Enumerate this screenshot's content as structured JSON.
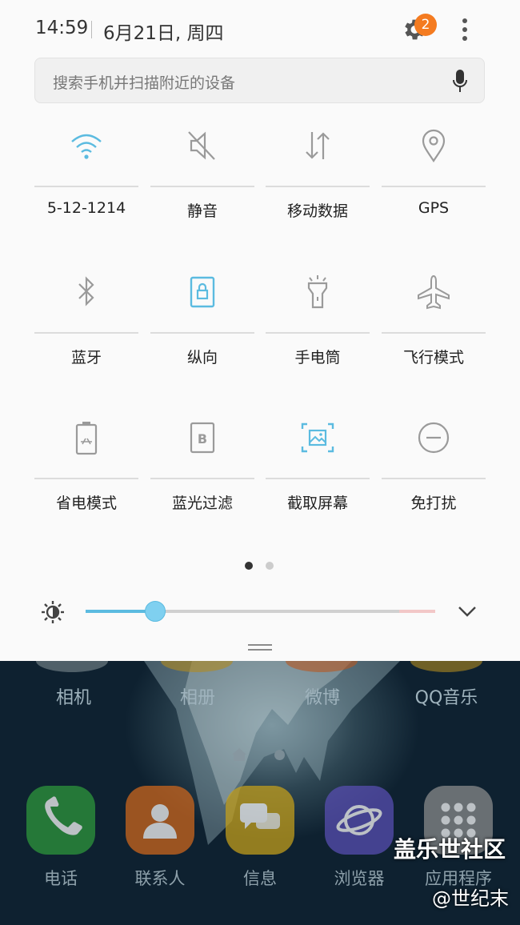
{
  "status_bar": {
    "time": "14:59",
    "date": "6月21日, 周四",
    "notification_count": "2"
  },
  "search": {
    "placeholder": "搜索手机并扫描附近的设备"
  },
  "quick_settings": [
    {
      "label": "5-12-1214",
      "icon": "wifi-icon",
      "active": true
    },
    {
      "label": "静音",
      "icon": "mute-icon",
      "active": false
    },
    {
      "label": "移动数据",
      "icon": "mobile-data-icon",
      "active": false
    },
    {
      "label": "GPS",
      "icon": "location-pin-icon",
      "active": false
    },
    {
      "label": "蓝牙",
      "icon": "bluetooth-icon",
      "active": false
    },
    {
      "label": "纵向",
      "icon": "portrait-lock-icon",
      "active": true
    },
    {
      "label": "手电筒",
      "icon": "flashlight-icon",
      "active": false
    },
    {
      "label": "飞行模式",
      "icon": "airplane-icon",
      "active": false
    },
    {
      "label": "省电模式",
      "icon": "power-saving-icon",
      "active": false
    },
    {
      "label": "蓝光过滤",
      "icon": "blue-light-filter-icon",
      "active": false
    },
    {
      "label": "截取屏幕",
      "icon": "screenshot-icon",
      "active": true
    },
    {
      "label": "免打扰",
      "icon": "do-not-disturb-icon",
      "active": false
    }
  ],
  "pager": {
    "pages": 2,
    "current": 1
  },
  "brightness": {
    "level": 0.2
  },
  "colors": {
    "accent": "#5bbbe0",
    "badge": "#f47b20",
    "inactive_icon": "#9a9a9a"
  },
  "home_screen": {
    "top_row": [
      "相机",
      "相册",
      "微博",
      "QQ音乐"
    ],
    "dock": [
      {
        "label": "电话",
        "icon": "phone-icon",
        "color": "#2e9a3c"
      },
      {
        "label": "联系人",
        "icon": "contact-icon",
        "color": "#d2681c"
      },
      {
        "label": "信息",
        "icon": "message-icon",
        "color": "#c7a11a"
      },
      {
        "label": "浏览器",
        "icon": "browser-icon",
        "color": "#5a4fb5"
      },
      {
        "label": "应用程序",
        "icon": "apps-icon",
        "color": "#8d8d8d"
      }
    ]
  },
  "watermark": {
    "line1": "盖乐世社区",
    "line2": "@世纪末"
  }
}
